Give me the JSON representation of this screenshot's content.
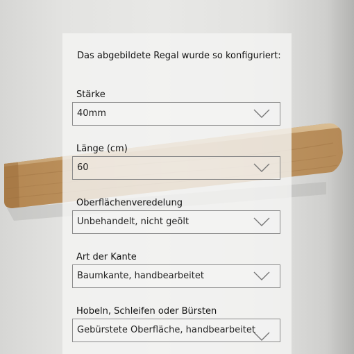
{
  "intro": "Das abgebildete Regal wurde so konfiguriert:",
  "fields": [
    {
      "label": "Stärke",
      "value": "40mm",
      "icon": "chevron-down-icon"
    },
    {
      "label": "Länge (cm)",
      "value": "60",
      "icon": "chevron-down-icon"
    },
    {
      "label": "Oberflächenveredelung",
      "value": "Unbehandelt, nicht geölt",
      "icon": "chevron-down-icon"
    },
    {
      "label": "Art der Kante",
      "value": "Baumkante, handbearbeitet",
      "icon": "chevron-down-icon"
    },
    {
      "label": "Hobeln, Schleifen oder Bürsten",
      "value": "Gebürstete Oberfläche, handbearbeitet",
      "icon": "chevron-down-icon"
    }
  ],
  "colors": {
    "wall": "#e6e6e4",
    "wood": "#c9a778",
    "wood_end": "#b98f5c",
    "panel": "#f4f4f2",
    "border": "#8a8a8a",
    "text": "#111111"
  }
}
